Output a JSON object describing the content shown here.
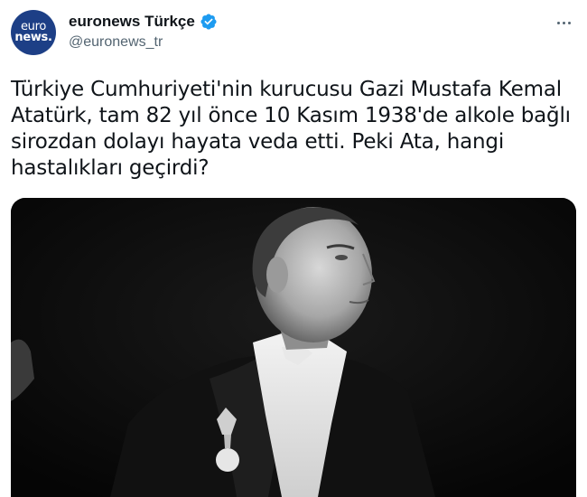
{
  "account": {
    "avatar_line1": "euro",
    "avatar_line2": "news.",
    "display_name": "euronews Türkçe",
    "handle": "@euronews_tr",
    "verified_icon": "verified-badge-icon"
  },
  "tweet": {
    "text": "Türkiye Cumhuriyeti'nin kurucusu Gazi Mustafa Kemal Atatürk, tam 82 yıl önce 10 Kasım 1938'de alkole bağlı sirozdan dolayı hayata veda etti. Peki Ata, hangi hastalıkları geçirdi?"
  },
  "colors": {
    "brand": "#1d3f86",
    "verified": "#1d9bf0",
    "secondary_text": "#536471"
  },
  "media": {
    "description_icon": "black-and-white-portrait-photo"
  }
}
